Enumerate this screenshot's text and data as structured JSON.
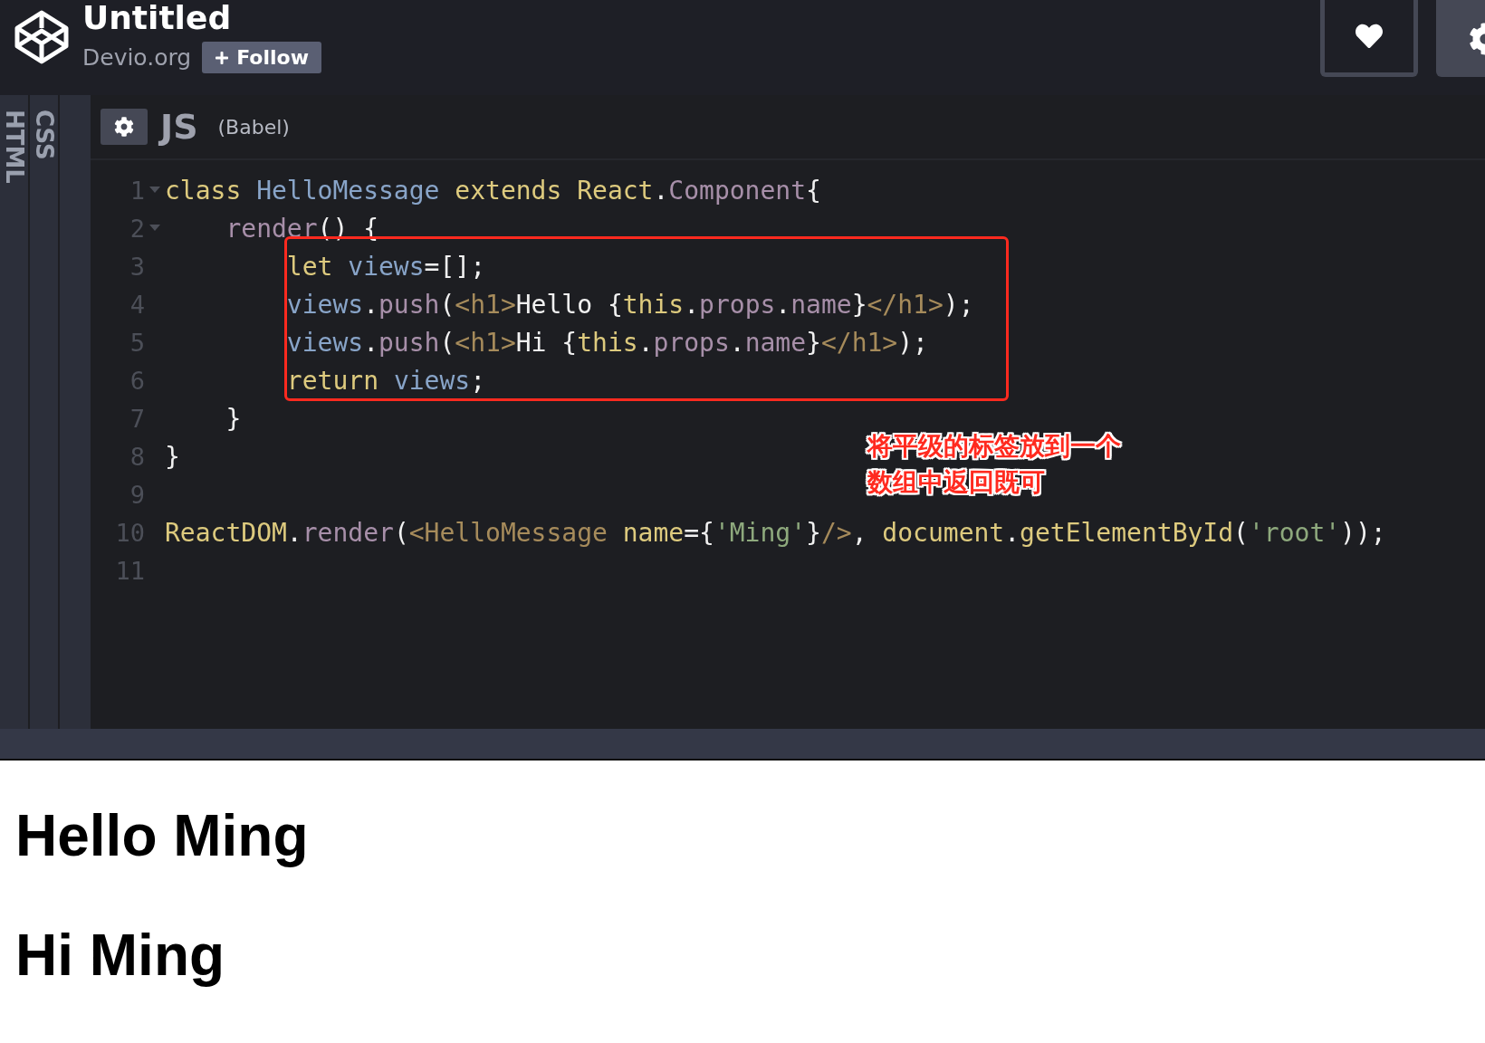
{
  "header": {
    "title": "Untitled",
    "owner": "Devio.org",
    "follow_button": {
      "label": "Follow"
    }
  },
  "side_tabs": [
    {
      "label": "HTML"
    },
    {
      "label": "CSS"
    }
  ],
  "editor": {
    "language": "JS",
    "preprocessor": "(Babel)",
    "lines": [
      {
        "number": "1",
        "foldable": true,
        "tokens": [
          {
            "kind": "keyword",
            "text": "class "
          },
          {
            "kind": "def",
            "text": "HelloMessage"
          },
          {
            "kind": "keyword",
            "text": " extends React"
          },
          {
            "kind": "plain",
            "text": "."
          },
          {
            "kind": "property",
            "text": "Component"
          },
          {
            "kind": "plain",
            "text": "{"
          }
        ]
      },
      {
        "number": "2",
        "foldable": true,
        "tokens": [
          {
            "kind": "property",
            "text": "    render"
          },
          {
            "kind": "plain",
            "text": "() {"
          }
        ]
      },
      {
        "number": "3",
        "foldable": false,
        "tokens": [
          {
            "kind": "keyword",
            "text": "        let "
          },
          {
            "kind": "def",
            "text": "views"
          },
          {
            "kind": "plain",
            "text": "=[];"
          }
        ]
      },
      {
        "number": "4",
        "foldable": false,
        "tokens": [
          {
            "kind": "def",
            "text": "        views"
          },
          {
            "kind": "plain",
            "text": "."
          },
          {
            "kind": "property",
            "text": "push"
          },
          {
            "kind": "plain",
            "text": "("
          },
          {
            "kind": "tag",
            "text": "<h1>"
          },
          {
            "kind": "plain",
            "text": "Hello {"
          },
          {
            "kind": "keyword",
            "text": "this"
          },
          {
            "kind": "plain",
            "text": "."
          },
          {
            "kind": "property",
            "text": "props"
          },
          {
            "kind": "plain",
            "text": "."
          },
          {
            "kind": "property",
            "text": "name"
          },
          {
            "kind": "plain",
            "text": "}"
          },
          {
            "kind": "tag",
            "text": "</h1>"
          },
          {
            "kind": "plain",
            "text": ");"
          }
        ]
      },
      {
        "number": "5",
        "foldable": false,
        "tokens": [
          {
            "kind": "def",
            "text": "        views"
          },
          {
            "kind": "plain",
            "text": "."
          },
          {
            "kind": "property",
            "text": "push"
          },
          {
            "kind": "plain",
            "text": "("
          },
          {
            "kind": "tag",
            "text": "<h1>"
          },
          {
            "kind": "plain",
            "text": "Hi {"
          },
          {
            "kind": "keyword",
            "text": "this"
          },
          {
            "kind": "plain",
            "text": "."
          },
          {
            "kind": "property",
            "text": "props"
          },
          {
            "kind": "plain",
            "text": "."
          },
          {
            "kind": "property",
            "text": "name"
          },
          {
            "kind": "plain",
            "text": "}"
          },
          {
            "kind": "tag",
            "text": "</h1>"
          },
          {
            "kind": "plain",
            "text": ");"
          }
        ]
      },
      {
        "number": "6",
        "foldable": false,
        "tokens": [
          {
            "kind": "keyword",
            "text": "        return "
          },
          {
            "kind": "def",
            "text": "views"
          },
          {
            "kind": "plain",
            "text": ";"
          }
        ]
      },
      {
        "number": "7",
        "foldable": false,
        "tokens": [
          {
            "kind": "plain",
            "text": "    }"
          }
        ]
      },
      {
        "number": "8",
        "foldable": false,
        "tokens": [
          {
            "kind": "plain",
            "text": "}"
          }
        ]
      },
      {
        "number": "9",
        "foldable": false
      },
      {
        "number": "10",
        "foldable": false,
        "tokens": [
          {
            "kind": "keyword",
            "text": "ReactDOM"
          },
          {
            "kind": "plain",
            "text": "."
          },
          {
            "kind": "property",
            "text": "render"
          },
          {
            "kind": "plain",
            "text": "("
          },
          {
            "kind": "tag",
            "text": "<HelloMessage"
          },
          {
            "kind": "keyword",
            "text": " name"
          },
          {
            "kind": "plain",
            "text": "={"
          },
          {
            "kind": "string",
            "text": "'Ming'"
          },
          {
            "kind": "plain",
            "text": "}"
          },
          {
            "kind": "tag",
            "text": "/>"
          },
          {
            "kind": "plain",
            "text": ", "
          },
          {
            "kind": "keyword",
            "text": "document"
          },
          {
            "kind": "plain",
            "text": "."
          },
          {
            "kind": "keyword",
            "text": "getElementById"
          },
          {
            "kind": "plain",
            "text": "("
          },
          {
            "kind": "string",
            "text": "'root'"
          },
          {
            "kind": "plain",
            "text": "));"
          }
        ]
      },
      {
        "number": "11",
        "foldable": false
      }
    ],
    "annotation": "将平级的标签放到一个数组中返回既可"
  },
  "preview": {
    "headings": [
      "Hello Ming",
      "Hi Ming"
    ]
  }
}
